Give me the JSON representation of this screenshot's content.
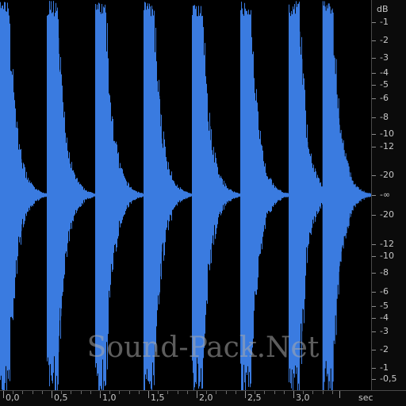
{
  "app": {
    "view": "waveform",
    "colors": {
      "waveform": "#3a7be0",
      "background": "#000000",
      "axis_text": "#c8c8c8"
    }
  },
  "db_scale": {
    "unit": "dB",
    "labels": [
      "dB",
      "-1",
      "-2",
      "-3",
      "-4",
      "-5",
      "-6",
      "-8",
      "-10",
      "-12",
      "-20",
      "-∞",
      "-20",
      "-12",
      "-10",
      "-8",
      "-6",
      "-5",
      "-4",
      "-3",
      "-2",
      "-1",
      "-0,5"
    ]
  },
  "time_axis": {
    "unit": "sec",
    "labels": [
      "0,0",
      "0,5",
      "1,0",
      "1,5",
      "2,0",
      "2,5",
      "3,0"
    ]
  },
  "waveform": {
    "bursts_at_seconds": [
      0.0,
      0.5,
      1.0,
      1.5,
      2.0,
      2.5,
      3.0,
      3.35
    ],
    "beat_interval_seconds": 0.5
  },
  "watermark": "Sound-Pack.Net"
}
